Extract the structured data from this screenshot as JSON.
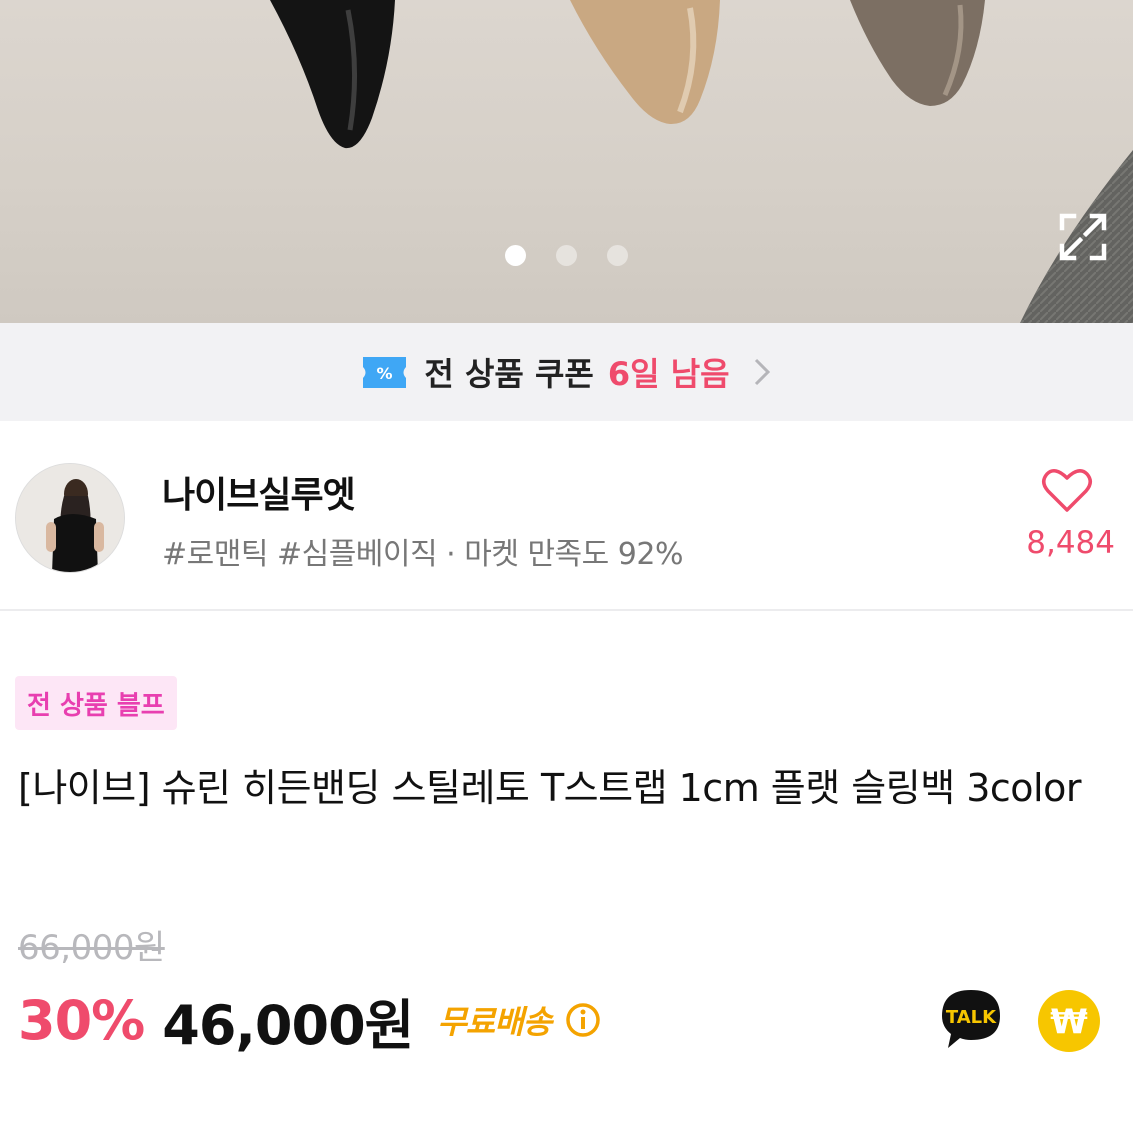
{
  "colors": {
    "accent_pink": "#ef4b6c",
    "badge_bg": "#fde6f6",
    "badge_text": "#e83fb0",
    "shipping": "#f4a300",
    "coupon_icon": "#3fa7f5",
    "pay_yellow": "#f7c600"
  },
  "carousel": {
    "total_slides": 3,
    "active_slide": 1
  },
  "coupon": {
    "icon": "coupon-ticket-icon",
    "label": "전 상품 쿠폰",
    "remaining": "6일 남음"
  },
  "seller": {
    "name": "나이브실루엣",
    "tags": "#로맨틱 #심플베이직 · 마켓 만족도 92%",
    "like_count": "8,484"
  },
  "product": {
    "badge": "전 상품 블프",
    "title": "[나이브] 슈린 히든밴딩 스틸레토 T스트랩 1cm 플랫 슬링백 3color",
    "original_price": "66,000원",
    "discount": "30%",
    "price": "46,000원",
    "shipping": "무료배송"
  },
  "actions": {
    "talk_label": "TALK",
    "pay_symbol": "₩"
  }
}
